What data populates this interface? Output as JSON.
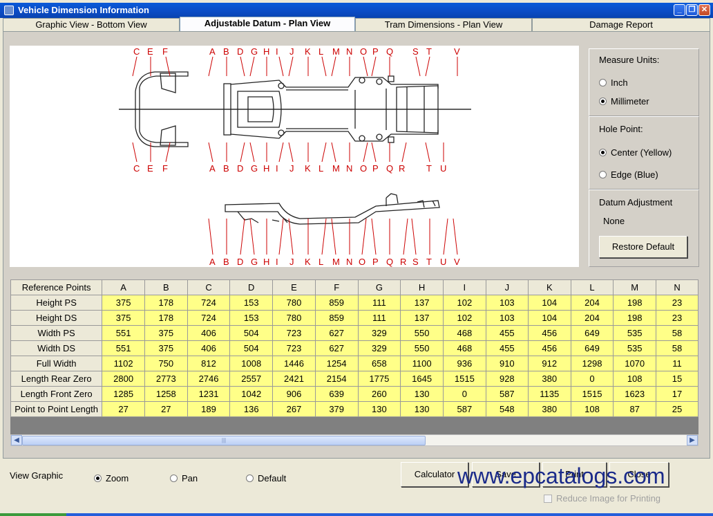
{
  "window": {
    "title": "Vehicle Dimension Information",
    "controls": [
      "_",
      "❐",
      "✕"
    ]
  },
  "tabs": [
    {
      "label": "Graphic View - Bottom View",
      "active": false
    },
    {
      "label": "Adjustable Datum - Plan View",
      "active": true
    },
    {
      "label": "Tram Dimensions - Plan View",
      "active": false
    },
    {
      "label": "Damage Report",
      "active": false
    }
  ],
  "drawing": {
    "top_labels_upper": [
      "C",
      "E",
      "F",
      "A",
      "B",
      "D",
      "G",
      "H",
      "I",
      "J",
      "K",
      "L",
      "M",
      "N",
      "O",
      "P",
      "Q",
      "S",
      "T",
      "V"
    ],
    "top_labels_lower": [
      "C",
      "E",
      "F",
      "A",
      "B",
      "D",
      "G",
      "H",
      "I",
      "J",
      "K",
      "L",
      "M",
      "N",
      "O",
      "P",
      "Q",
      "R",
      "T",
      "U"
    ],
    "side_labels": [
      "A",
      "B",
      "D",
      "G",
      "H",
      "I",
      "J",
      "K",
      "L",
      "M",
      "N",
      "O",
      "P",
      "Q",
      "R",
      "S",
      "T",
      "U",
      "V"
    ]
  },
  "measure_units": {
    "title": "Measure Units:",
    "options": [
      {
        "label": "Inch",
        "selected": false
      },
      {
        "label": "Millimeter",
        "selected": true
      }
    ]
  },
  "hole_point": {
    "title": "Hole Point:",
    "options": [
      {
        "label": "Center (Yellow)",
        "selected": true
      },
      {
        "label": "Edge (Blue)",
        "selected": false
      }
    ]
  },
  "datum_adjustment": {
    "title": "Datum Adjustment",
    "value": "None",
    "restore_label": "Restore Default"
  },
  "table": {
    "corner": "Reference Points",
    "columns": [
      "A",
      "B",
      "C",
      "D",
      "E",
      "F",
      "G",
      "H",
      "I",
      "J",
      "K",
      "L",
      "M",
      "N"
    ],
    "rows": [
      {
        "label": "Height PS",
        "values": [
          "375",
          "178",
          "724",
          "153",
          "780",
          "859",
          "111",
          "137",
          "102",
          "103",
          "104",
          "204",
          "198",
          "23"
        ]
      },
      {
        "label": "Height DS",
        "values": [
          "375",
          "178",
          "724",
          "153",
          "780",
          "859",
          "111",
          "137",
          "102",
          "103",
          "104",
          "204",
          "198",
          "23"
        ]
      },
      {
        "label": "Width PS",
        "values": [
          "551",
          "375",
          "406",
          "504",
          "723",
          "627",
          "329",
          "550",
          "468",
          "455",
          "456",
          "649",
          "535",
          "58"
        ]
      },
      {
        "label": "Width DS",
        "values": [
          "551",
          "375",
          "406",
          "504",
          "723",
          "627",
          "329",
          "550",
          "468",
          "455",
          "456",
          "649",
          "535",
          "58"
        ]
      },
      {
        "label": "Full Width",
        "values": [
          "1102",
          "750",
          "812",
          "1008",
          "1446",
          "1254",
          "658",
          "1100",
          "936",
          "910",
          "912",
          "1298",
          "1070",
          "11"
        ]
      },
      {
        "label": "Length Rear Zero",
        "values": [
          "2800",
          "2773",
          "2746",
          "2557",
          "2421",
          "2154",
          "1775",
          "1645",
          "1515",
          "928",
          "380",
          "0",
          "108",
          "15"
        ]
      },
      {
        "label": "Length Front Zero",
        "values": [
          "1285",
          "1258",
          "1231",
          "1042",
          "906",
          "639",
          "260",
          "130",
          "0",
          "587",
          "1135",
          "1515",
          "1623",
          "17"
        ]
      },
      {
        "label": "Point to Point Length",
        "values": [
          "27",
          "27",
          "189",
          "136",
          "267",
          "379",
          "130",
          "130",
          "587",
          "548",
          "380",
          "108",
          "87",
          "25"
        ]
      }
    ]
  },
  "view_graphic": {
    "label": "View Graphic",
    "options": [
      {
        "label": "Zoom",
        "selected": true
      },
      {
        "label": "Pan",
        "selected": false
      },
      {
        "label": "Default",
        "selected": false
      }
    ]
  },
  "buttons": {
    "calculator": "Calculator",
    "save": "Save",
    "print": "Print",
    "close": "Close"
  },
  "reduce_image_label": "Reduce Image for Printing",
  "watermark": "www.epcatalogs.com",
  "colors": {
    "value_cell": "#ffff88",
    "title_bar": "#0a5ad8",
    "label_red": "#cc0000"
  }
}
